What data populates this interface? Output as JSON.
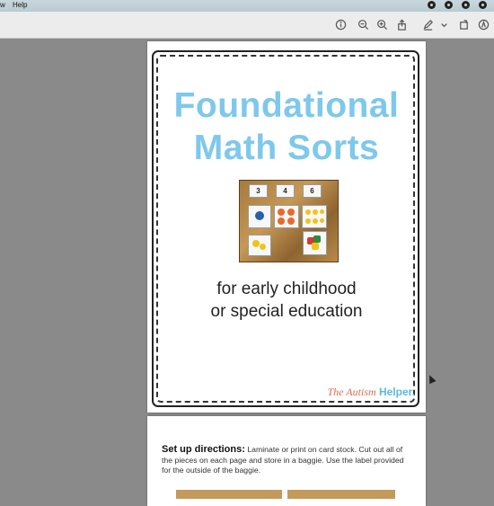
{
  "menubar": {
    "items": [
      "w",
      "Help"
    ]
  },
  "toolbar": {
    "icons": [
      "info-icon",
      "zoom-out-icon",
      "zoom-in-icon",
      "share-icon",
      "markup-pen-icon",
      "chevron-down-icon",
      "rotate-icon",
      "annotate-icon"
    ]
  },
  "page1": {
    "title_line1": "Foundational",
    "title_line2": "Math Sorts",
    "cards": [
      "3",
      "4",
      "6"
    ],
    "subtitle_line1": "for early childhood",
    "subtitle_line2": "or special education",
    "logo_part1": "The Autism",
    "logo_part2": "Helper."
  },
  "page2": {
    "setup_heading": "Set up directions:",
    "setup_text": "Laminate or print on card stock. Cut out all of the pieces on each page and store in a baggie. Use the label provided for the outside of the baggie."
  },
  "colors": {
    "title": "#7ec8ec",
    "logo_red": "#e06a55",
    "logo_blue": "#5bb9e3",
    "background": "#8a8a8a"
  }
}
